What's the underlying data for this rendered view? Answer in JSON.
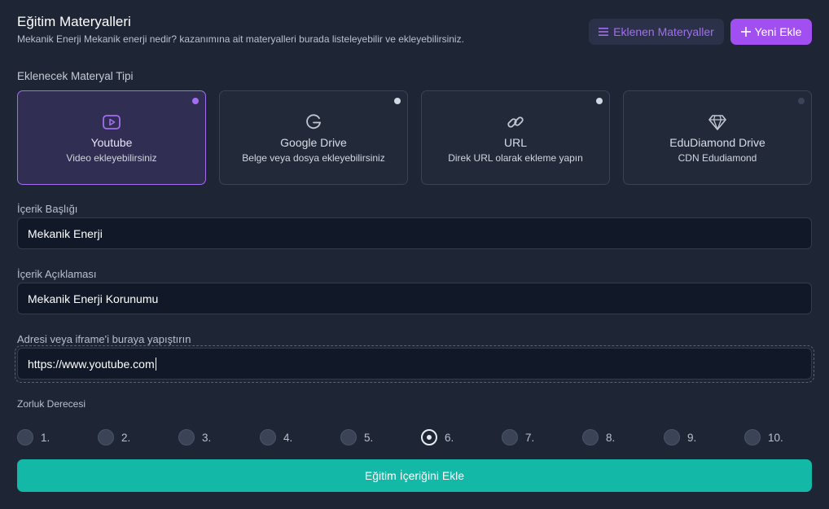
{
  "header": {
    "title": "Eğitim Materyalleri",
    "subtitle": "Mekanik Enerji Mekanik enerji nedir? kazanımına ait materyalleri burada listeleyebilir ve ekleyebilirsiniz.",
    "list_button": "Eklenen Materyaller",
    "new_button": "Yeni Ekle"
  },
  "material_type": {
    "label": "Eklenecek Materyal Tipi",
    "cards": [
      {
        "name": "Youtube",
        "desc": "Video ekleyebilirsiniz",
        "icon": "youtube-icon"
      },
      {
        "name": "Google Drive",
        "desc": "Belge veya dosya ekleyebilirsiniz",
        "icon": "google-icon"
      },
      {
        "name": "URL",
        "desc": "Direk URL olarak ekleme yapın",
        "icon": "link-icon"
      },
      {
        "name": "EduDiamond Drive",
        "desc": "CDN Edudiamond",
        "icon": "diamond-icon"
      }
    ],
    "selected": "Youtube"
  },
  "form": {
    "title_label": "İçerik Başlığı",
    "title_value": "Mekanik Enerji",
    "desc_label": "İçerik Açıklaması",
    "desc_value": "Mekanik Enerji Korunumu",
    "url_label": "Adresi veya iframe'i buraya yapıştırın",
    "url_value": "https://www.youtube.com"
  },
  "difficulty": {
    "label": "Zorluk Derecesi",
    "options": [
      "1.",
      "2.",
      "3.",
      "4.",
      "5.",
      "6.",
      "7.",
      "8.",
      "9.",
      "10."
    ],
    "selected": "6."
  },
  "submit_label": "Eğitim İçeriğini Ekle",
  "colors": {
    "background": "#1e2535",
    "accent_purple": "#a24ff2",
    "accent_teal": "#14b8a6",
    "input_bg": "#111827"
  }
}
